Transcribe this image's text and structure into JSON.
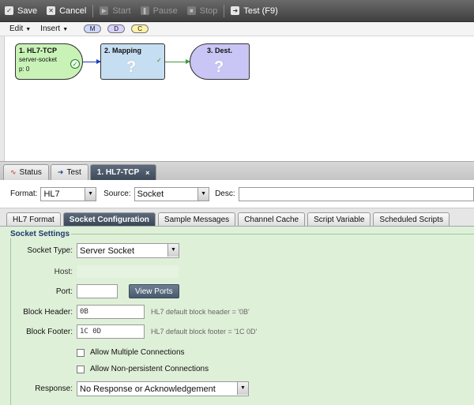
{
  "toolbar": {
    "save": "Save",
    "cancel": "Cancel",
    "start": "Start",
    "pause": "Pause",
    "stop": "Stop",
    "test": "Test (F9)"
  },
  "subbar": {
    "edit": "Edit",
    "insert": "Insert",
    "pills": [
      "M",
      "D",
      "C"
    ]
  },
  "diagram": {
    "node1": {
      "title": "1. HL7-TCP",
      "line1": "server-socket",
      "line2": "p: 0"
    },
    "node2": {
      "title": "2. Mapping",
      "icon": "?"
    },
    "node3": {
      "title": "3. Dest.",
      "icon": "?"
    }
  },
  "bottom_tabs": {
    "status": "Status",
    "test": "Test",
    "active": "1. HL7-TCP",
    "close": "×"
  },
  "config": {
    "format_label": "Format:",
    "format_value": "HL7",
    "source_label": "Source:",
    "source_value": "Socket",
    "desc_label": "Desc:"
  },
  "inner_tabs": [
    "HL7 Format",
    "Socket Configuration",
    "Sample Messages",
    "Channel Cache",
    "Script Variable",
    "Scheduled Scripts"
  ],
  "settings": {
    "legend": "Socket Settings",
    "socket_type_label": "Socket Type:",
    "socket_type_value": "Server Socket",
    "host_label": "Host:",
    "port_label": "Port:",
    "view_ports": "View Ports",
    "block_header_label": "Block Header:",
    "block_header_value": "0B",
    "block_header_hint": "HL7 default block header = '0B'",
    "block_footer_label": "Block Footer:",
    "block_footer_value": "1C 0D",
    "block_footer_hint": "HL7 default block footer = '1C 0D'",
    "allow_multiple": "Allow Multiple Connections",
    "allow_nonpersistent": "Allow Non-persistent Connections",
    "response_label": "Response:",
    "response_value": "No Response or Acknowledgement"
  }
}
